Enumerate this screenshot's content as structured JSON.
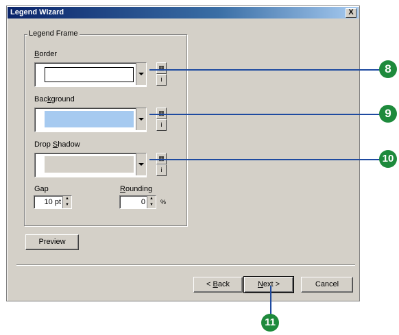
{
  "window": {
    "title": "Legend Wizard",
    "close_glyph": "X"
  },
  "frame": {
    "group_label": "Legend Frame",
    "border": {
      "label_pre": "",
      "label_accel": "B",
      "label_post": "order",
      "fill": "#ffffff",
      "outlined": true
    },
    "background": {
      "label_pre": "Bac",
      "label_accel": "k",
      "label_post": "ground",
      "fill": "#a6caf0"
    },
    "drop_shadow": {
      "label_pre": "Drop ",
      "label_accel": "S",
      "label_post": "hadow",
      "fill": "#d4d0c8"
    },
    "gap": {
      "label": "Gap",
      "value": "10 pt"
    },
    "rounding": {
      "label_pre": "",
      "label_accel": "R",
      "label_post": "ounding",
      "value": "0",
      "unit": "%"
    }
  },
  "buttons": {
    "preview": "Preview",
    "back_pre": "< ",
    "back_accel": "B",
    "back_post": "ack",
    "next_accel": "N",
    "next_post": "ext >",
    "cancel": "Cancel"
  },
  "callouts": [
    "8",
    "9",
    "10",
    "11"
  ]
}
